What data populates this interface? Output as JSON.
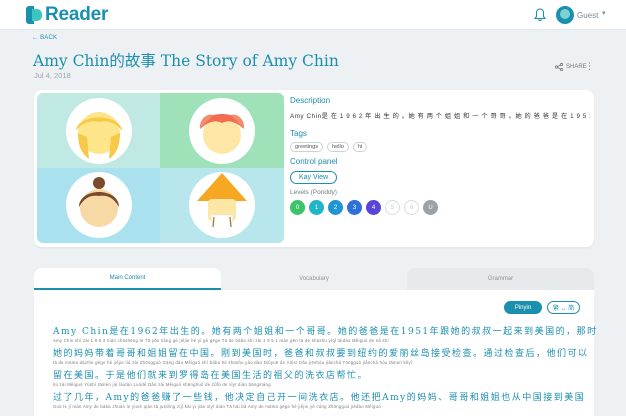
{
  "app": {
    "name": "Reader"
  },
  "user": {
    "name": "Guest"
  },
  "back_label": "BACK",
  "story": {
    "title": "Amy Chin的故事 The Story of Amy Chin",
    "date": "Jul 4, 2018"
  },
  "actions": {
    "share_label": "SHARE"
  },
  "details": {
    "description_label": "Description",
    "description": "Amy Chin是 在 1 9 6 2 年 出 生 的 。她 有 两 个 姐 姐 和 一 个 哥 哥 。她 的 爸 爸 是 在 1 9 5 1 年 ...",
    "tags_label": "Tags",
    "tags": [
      "greetings",
      "hello",
      "hi"
    ],
    "control_label": "Control panel",
    "control_button": "Kay View",
    "levels_label": "Levels (Ponddy)",
    "levels": [
      {
        "label": "0",
        "color": "#3cc46a"
      },
      {
        "label": "1",
        "color": "#1fb5c9"
      },
      {
        "label": "2",
        "color": "#1f95d4"
      },
      {
        "label": "3",
        "color": "#2f6fd8"
      },
      {
        "label": "4",
        "color": "#5a46d6"
      },
      {
        "label": "5",
        "color": "#ffffff"
      },
      {
        "label": "6",
        "color": "#ffffff"
      },
      {
        "label": "U",
        "color": "#9aa2a6"
      }
    ]
  },
  "tabs": [
    "Main Content",
    "Vocabulary",
    "Grammar"
  ],
  "reader": {
    "pinyin_button": "Pinyin",
    "script_button": "繁 ↔ 简",
    "lines": [
      {
        "zh": "Amy Chin是在1962年出生的。她有两个姐姐和一个哥哥。她的爸爸是在1951年跟她的叔叔一起来到美国的，那时",
        "py": "Amy  Chin  shì  zài  1 9 6 2  nián chūshēng  le      Tā  yǒu  liǎng  gè  jiějie  hé  yí  gè  gēge     Tā  de  bàba  shì  zài  1 9 5 1  nián  gēn  tā  de  shūshu  yìqǐ  láidào  Měiguó  de    nà  shí"
      },
      {
        "zh": "她的妈妈带着哥哥和姐姐留在中国。刚到美国时，爸爸和叔叔要到纽约的爱丽丝岛接受检查。通过检查后，他们可以",
        "py": "tā  de  māma  dàizhe  gēge  hé  jiějie  liú  zài  Zhōngguó   Gāng  dào  Měiguó  shí   bàba  hé  shūshu  yào  dào  Niǔyuē  de  Àilìsī  Dǎo  jiēshòu  jiǎnchá    Tōngguò  jiǎnchá  hòu   tāmen  kěyǐ"
      },
      {
        "zh": "留在美国。于是他们就来到罗得岛在美国生活的祖父的洗衣店帮忙。",
        "py": "liú  zài  Měiguó    Yúshì  tāmen  jiù  láidào  Luódé  Dǎo  zài  Měiguó  shēnghuó  de  zǔfù  de  xǐyī  diàn  bāngmáng"
      },
      {
        "zh": "过了几年，Amy的爸爸赚了一些钱，他决定自己开一间洗衣店。他还把Amy的妈妈、哥哥和姐姐也从中国接到美国",
        "py": "Guò  le  jǐ  nián    Amy  de  bàba  zhuàn  le  yìxiē  qián    tā  juédìng  zìjǐ  kāi  yì  jiān  xǐyī  diàn   Tā  hái  bǎ  Amy  de  māma   gēge  hé  jiějie  yě  cóng  Zhōngguó  jiēdào  Měiguó"
      }
    ]
  }
}
